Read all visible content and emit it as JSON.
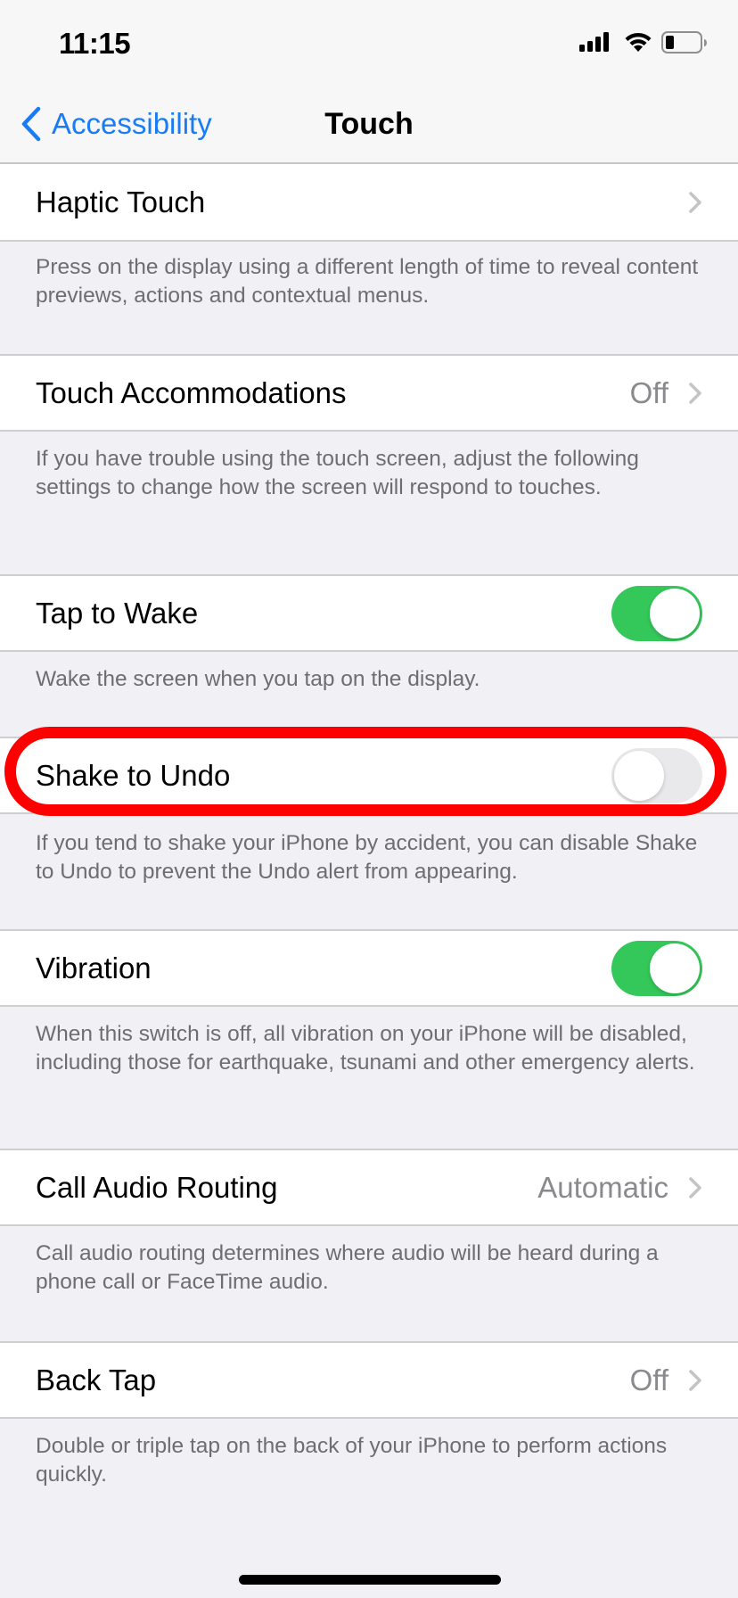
{
  "status_bar": {
    "time": "11:15",
    "icons": [
      "cellular-signal-icon",
      "wifi-icon",
      "battery-icon"
    ]
  },
  "nav": {
    "back_label": "Accessibility",
    "title": "Touch"
  },
  "colors": {
    "accent": "#1A7CF5",
    "toggle_on": "#34C759",
    "toggle_off": "#E9E9EB",
    "highlight": "#FF0000",
    "background": "#F0F0F5"
  },
  "rows": [
    {
      "label": "Haptic Touch",
      "type": "disclosure",
      "value": null,
      "footer": "Press on the display using a different length of time to reveal content previews, actions and contextual menus."
    },
    {
      "label": "Touch Accommodations",
      "type": "disclosure",
      "value": "Off",
      "footer": "If you have trouble using the touch screen, adjust the following settings to change how the screen will respond to touches."
    },
    {
      "label": "Tap to Wake",
      "type": "toggle",
      "state": "on",
      "footer": "Wake the screen when you tap on the display."
    },
    {
      "label": "Shake to Undo",
      "type": "toggle",
      "state": "off",
      "highlighted": true,
      "footer": "If you tend to shake your iPhone by accident, you can disable Shake to Undo to prevent the Undo alert from appearing."
    },
    {
      "label": "Vibration",
      "type": "toggle",
      "state": "on",
      "footer": "When this switch is off, all vibration on your iPhone will be disabled, including those for earthquake, tsunami and other emergency alerts."
    },
    {
      "label": "Call Audio Routing",
      "type": "disclosure",
      "value": "Automatic",
      "footer": "Call audio routing determines where audio will be heard during a phone call or FaceTime audio."
    },
    {
      "label": "Back Tap",
      "type": "disclosure",
      "value": "Off",
      "footer": "Double or triple tap on the back of your iPhone to perform actions quickly."
    }
  ]
}
